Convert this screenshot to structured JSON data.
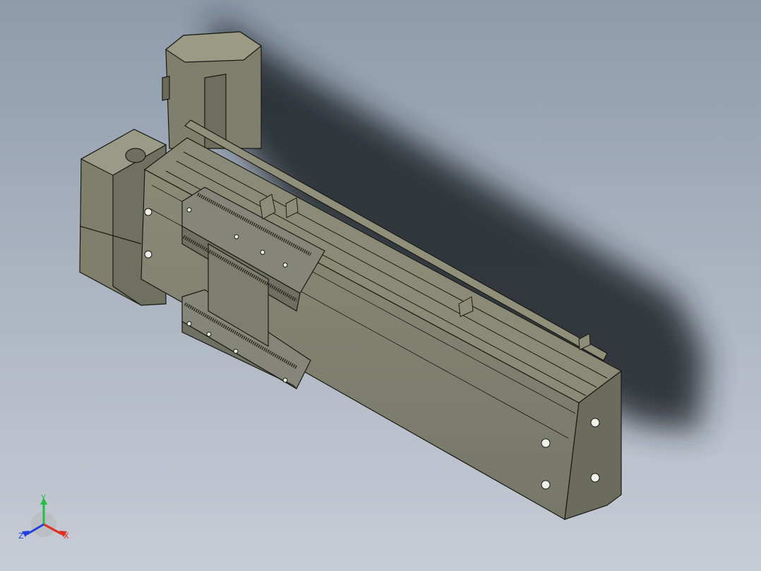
{
  "viewport": {
    "background_top": "#8e9bab",
    "background_bottom": "#c7ccd6",
    "model_color": "#7d7d6c",
    "edge_color": "#1a1a14"
  },
  "triad": {
    "x_label": "X",
    "y_label": "Y",
    "z_label": "Z",
    "x_color": "#e03020",
    "y_color": "#20c040",
    "z_color": "#2040e0"
  }
}
